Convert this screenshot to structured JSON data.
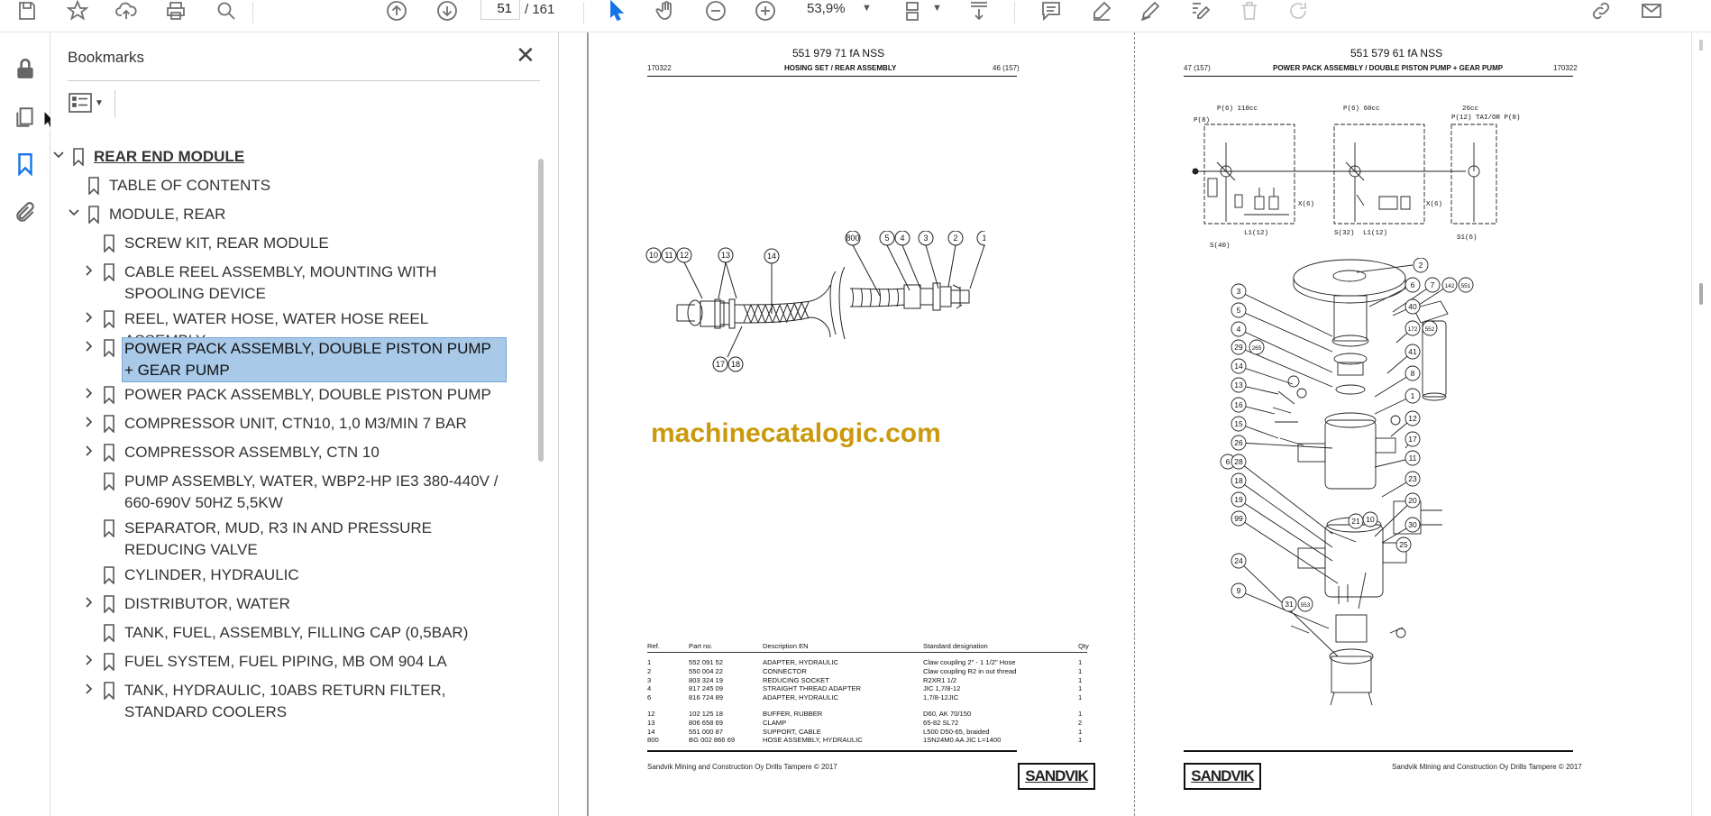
{
  "toolbar": {
    "page_current": "51",
    "page_total": "/ 161",
    "zoom": "53,9%",
    "icons": [
      "save-icon",
      "star-icon",
      "upload-icon",
      "print-icon",
      "search-icon",
      "page-up-icon",
      "page-down-icon",
      "select-cursor-icon",
      "hand-icon",
      "zoom-out-icon",
      "zoom-in-icon",
      "page-fit-icon",
      "scroll-mode-icon",
      "comment-icon",
      "highlight-icon",
      "draw-icon",
      "edit-icon",
      "delete-icon",
      "redo-icon",
      "share-link-icon",
      "mail-icon"
    ]
  },
  "rail": {
    "icons": [
      "lock-icon",
      "pages-icon",
      "bookmark-icon",
      "attachment-icon"
    ]
  },
  "panel": {
    "title": "Bookmarks",
    "items": [
      {
        "label": "REAR END MODULE",
        "level": 0,
        "expand": "open",
        "root": true
      },
      {
        "label": "TABLE OF CONTENTS",
        "level": 1,
        "expand": "none"
      },
      {
        "label": "MODULE, REAR",
        "level": 1,
        "expand": "open"
      },
      {
        "label": "SCREW KIT, REAR MODULE",
        "level": 2,
        "expand": "none"
      },
      {
        "label": "CABLE REEL ASSEMBLY, MOUNTING WITH SPOOLING DEVICE",
        "level": 2,
        "expand": "closed"
      },
      {
        "label": "REEL, WATER HOSE, WATER HOSE REEL ASSEMBLY",
        "level": 2,
        "expand": "closed"
      },
      {
        "label": "POWER PACK ASSEMBLY, DOUBLE PISTON PUMP + GEAR PUMP",
        "level": 2,
        "expand": "closed",
        "selected": true
      },
      {
        "label": "POWER PACK ASSEMBLY, DOUBLE PISTON PUMP",
        "level": 2,
        "expand": "closed"
      },
      {
        "label": "COMPRESSOR UNIT, CTN10, 1,0 M3/MIN 7 BAR",
        "level": 2,
        "expand": "closed"
      },
      {
        "label": "COMPRESSOR ASSEMBLY, CTN 10",
        "level": 2,
        "expand": "closed"
      },
      {
        "label": "PUMP ASSEMBLY, WATER, WBP2-HP IE3 380-440V / 660-690V 50HZ 5,5KW",
        "level": 2,
        "expand": "none"
      },
      {
        "label": "SEPARATOR, MUD, R3 IN AND PRESSURE REDUCING VALVE",
        "level": 2,
        "expand": "none"
      },
      {
        "label": "CYLINDER, HYDRAULIC",
        "level": 2,
        "expand": "none"
      },
      {
        "label": "DISTRIBUTOR, WATER",
        "level": 2,
        "expand": "closed"
      },
      {
        "label": "TANK, FUEL, ASSEMBLY, FILLING CAP (0,5BAR)",
        "level": 2,
        "expand": "none"
      },
      {
        "label": "FUEL SYSTEM, FUEL PIPING, MB OM 904 LA",
        "level": 2,
        "expand": "closed"
      },
      {
        "label": "TANK, HYDRAULIC, 10ABS RETURN FILTER, STANDARD COOLERS",
        "level": 2,
        "expand": "closed"
      }
    ]
  },
  "left_page": {
    "doc_number": "551 979 71 fA NSS",
    "date_code": "170322",
    "title": "HOSING SET / REAR ASSEMBLY",
    "page_ref": "46 (157)",
    "balloons_top": [
      "10",
      "11",
      "12",
      "13",
      "14",
      "800",
      "5",
      "4",
      "3",
      "2",
      "1"
    ],
    "balloons_bottom": [
      "17",
      "18"
    ],
    "watermark": "machinecatalogic.com",
    "table": {
      "headers": [
        "Ref.",
        "Part no.",
        "Description EN",
        "Standard designation",
        "Qty"
      ],
      "rows": [
        [
          "1",
          "552 091 52",
          "ADAPTER, HYDRAULIC",
          "Claw coupling 2\" - 1 1/2\" Hose",
          "1"
        ],
        [
          "2",
          "550 004 22",
          "CONNECTOR",
          "Claw coupling R2 in out thread",
          "1"
        ],
        [
          "3",
          "803 324 19",
          "REDUCING SOCKET",
          "R2XR1 1/2",
          "1"
        ],
        [
          "4",
          "817 245 09",
          "STRAIGHT THREAD ADAPTER",
          "JIC 1,7/8-12",
          "1"
        ],
        [
          "6",
          "816 724 89",
          "ADAPTER, HYDRAULIC",
          "1,7/8-12JIC",
          "1"
        ],
        [
          "12",
          "102 125 18",
          "BUFFER, RUBBER",
          "D60, AK 70/150",
          "1"
        ],
        [
          "13",
          "806 658 69",
          "CLAMP",
          "65-82 SL72",
          "2"
        ],
        [
          "14",
          "551 000 87",
          "SUPPORT, CABLE",
          "L500 D50-65, braided",
          "1"
        ],
        [
          "800",
          "BG 002 866 69",
          "HOSE ASSEMBLY, HYDRAULIC",
          "1SN24M0 AA JIC L=1400",
          "1"
        ]
      ]
    },
    "footer": "Sandvik Mining and Construction Oy Drills Tampere © 2017",
    "brand": "SANDVIK"
  },
  "right_page": {
    "doc_number": "551 579 61 fA NSS",
    "page_ref": "47 (157)",
    "title": "POWER PACK ASSEMBLY / DOUBLE PISTON PUMP + GEAR PUMP",
    "date_code": "170322",
    "schematic_labels": [
      "P(6) 110cc",
      "P(8)",
      "P(6) 60cc",
      "26cc",
      "P(12) TAI/OR P(8)",
      "X(6)",
      "X(6)",
      "L1(12)",
      "S(40)",
      "S(32)",
      "L1(12)",
      "S1(6)"
    ],
    "balloons": [
      "2",
      "3",
      "5",
      "4",
      "29",
      "265",
      "14",
      "13",
      "16",
      "15",
      "26",
      "6",
      "28",
      "18",
      "19",
      "99",
      "24",
      "9",
      "31",
      "553",
      "6",
      "7",
      "142",
      "551",
      "40",
      "172",
      "552",
      "41",
      "8",
      "1",
      "12",
      "10",
      "17",
      "11",
      "23",
      "21",
      "20",
      "30",
      "25"
    ],
    "footer": "Sandvik Mining and Construction Oy Drills Tampere © 2017",
    "brand": "SANDVIK"
  }
}
